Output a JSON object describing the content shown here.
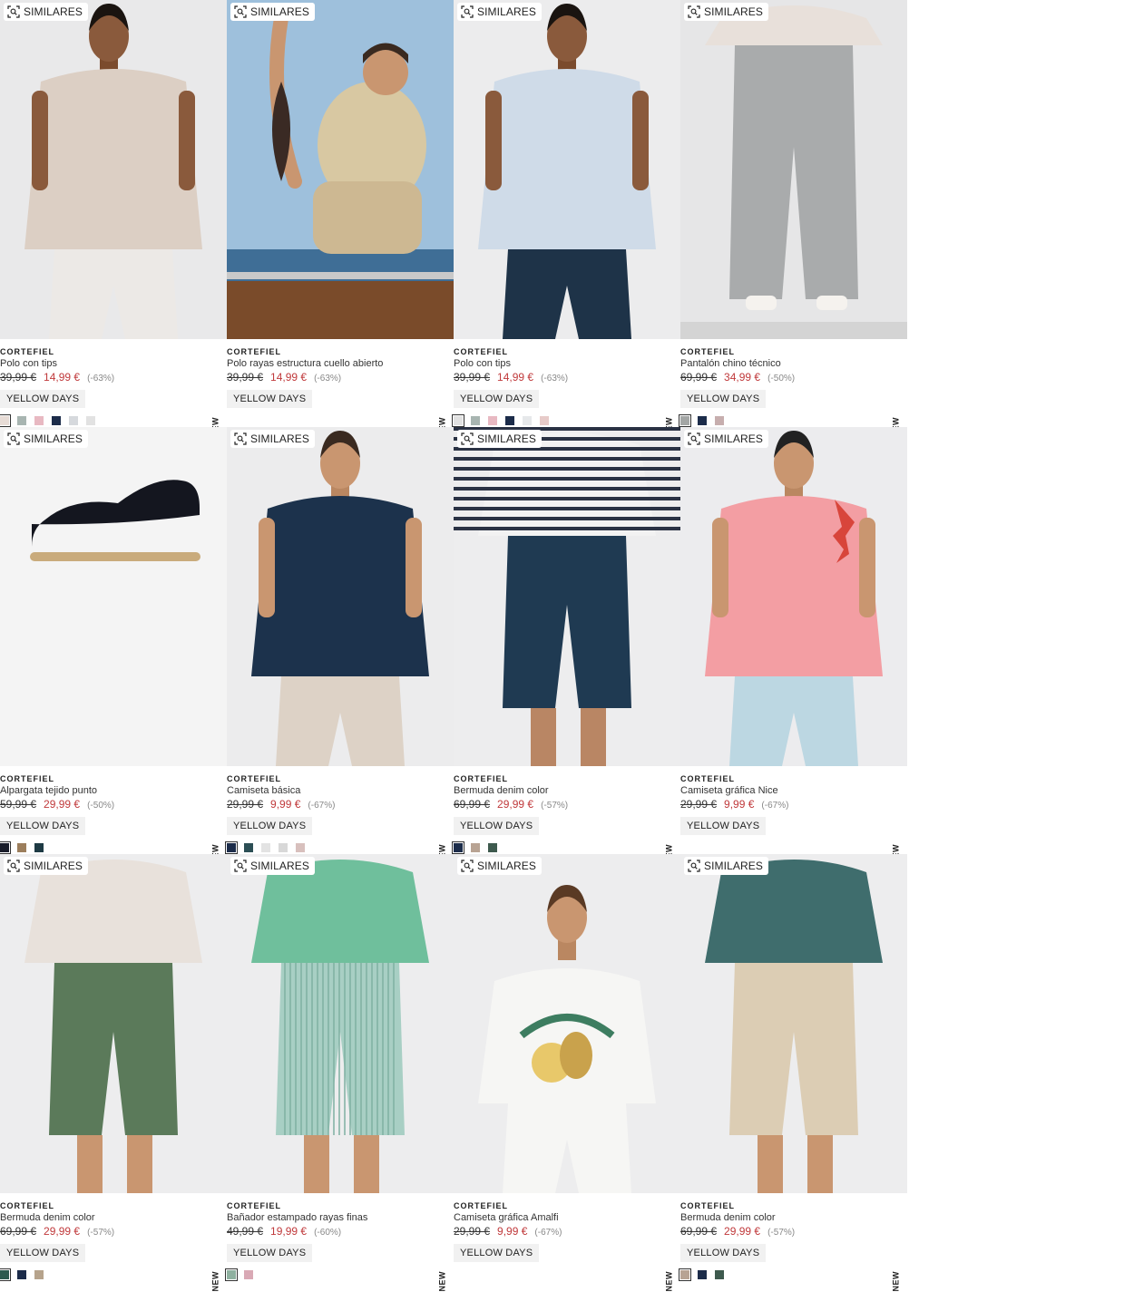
{
  "labels": {
    "similares": "SIMILARES",
    "new": "NEW",
    "badge": "YELLOW DAYS"
  },
  "products": [
    {
      "brand": "CORTEFIEL",
      "name": "Polo con tips",
      "old_price": "39,99 €",
      "price": "14,99 €",
      "discount": "(-63%)",
      "bg": "#e9e9ea",
      "colors": [
        "#e7dcd6",
        "#a8b5b1",
        "#e8b9c2",
        "#1c2c4a",
        "#d6d9dd",
        "#e2e2e2"
      ],
      "photo": {
        "skin": "#8a5a3c",
        "hair": "#1a1410",
        "top": "#dccfc4",
        "bottom": "#ece9e6",
        "view": "side"
      }
    },
    {
      "brand": "CORTEFIEL",
      "name": "Polo rayas estructura cuello abierto",
      "old_price": "39,99 €",
      "price": "14,99 €",
      "discount": "(-63%)",
      "bg": "#8fb0cf",
      "colors": [],
      "photo": {
        "skin": "#c99670",
        "hair": "#3a2a20",
        "top": "#d8c8a2",
        "bottom": "#cdb892",
        "view": "boat"
      }
    },
    {
      "brand": "CORTEFIEL",
      "name": "Polo con tips",
      "old_price": "39,99 €",
      "price": "14,99 €",
      "discount": "(-63%)",
      "bg": "#ececed",
      "colors": [
        "#e1e1e1",
        "#a8b5b1",
        "#e8b9c2",
        "#1c2c4a",
        "#e6e8ea",
        "#e7cbc9"
      ],
      "photo": {
        "skin": "#8a5a3c",
        "hair": "#1a1410",
        "top": "#cfdbe8",
        "bottom": "#1e3348",
        "view": "front"
      }
    },
    {
      "brand": "CORTEFIEL",
      "name": "Pantalón chino técnico",
      "old_price": "69,99 €",
      "price": "34,99 €",
      "discount": "(-50%)",
      "bg": "#e6e6e7",
      "colors": [
        "#a3a6a5",
        "#1c2c4a",
        "#c7aeae"
      ],
      "photo": {
        "skin": "#c99670",
        "hair": "#222",
        "top": "#e8e0da",
        "bottom": "#a9abac",
        "view": "pants"
      }
    },
    {
      "brand": "CORTEFIEL",
      "name": "Alpargata tejido punto",
      "old_price": "59,99 €",
      "price": "29,99 €",
      "discount": "(-50%)",
      "bg": "#f4f4f4",
      "colors": [
        "#1a1d2a",
        "#9c7e5c",
        "#1e3a44"
      ],
      "photo": {
        "view": "shoe"
      }
    },
    {
      "brand": "CORTEFIEL",
      "name": "Camiseta básica",
      "old_price": "29,99 €",
      "price": "9,99 €",
      "discount": "(-67%)",
      "bg": "#ececed",
      "colors": [
        "#1c2c4a",
        "#2c4f55",
        "#e3e3e3",
        "#d8d8d8",
        "#d8c0bd"
      ],
      "photo": {
        "skin": "#c99670",
        "hair": "#3a2a20",
        "top": "#1c324c",
        "bottom": "#ddd2c6",
        "view": "front"
      }
    },
    {
      "brand": "CORTEFIEL",
      "name": "Bermuda denim color",
      "old_price": "69,99 €",
      "price": "29,99 €",
      "discount": "(-57%)",
      "bg": "#ededee",
      "colors": [
        "#1c2c4a",
        "#b8a393",
        "#3e5a4e"
      ],
      "photo": {
        "skin": "#b98664",
        "hair": "#222",
        "top": "#f2f2f2",
        "bottom": "#1f3a52",
        "view": "shorts-stripes"
      }
    },
    {
      "brand": "CORTEFIEL",
      "name": "Camiseta gráfica Nice",
      "old_price": "29,99 €",
      "price": "9,99 €",
      "discount": "(-67%)",
      "bg": "#ececee",
      "colors": [],
      "photo": {
        "skin": "#c99670",
        "hair": "#222",
        "top": "#f39ea3",
        "bottom": "#bcd7e2",
        "view": "tee"
      }
    },
    {
      "brand": "CORTEFIEL",
      "name": "Bermuda denim color",
      "old_price": "69,99 €",
      "price": "29,99 €",
      "discount": "(-57%)",
      "bg": "#ededee",
      "colors": [
        "#2c5a4e",
        "#1c2c4a",
        "#b6a38c"
      ],
      "photo": {
        "skin": "#c99670",
        "hair": "#222",
        "top": "#e8e1db",
        "bottom": "#5b7a5a",
        "view": "shorts"
      }
    },
    {
      "brand": "CORTEFIEL",
      "name": "Bañador estampado rayas finas",
      "old_price": "49,99 €",
      "price": "19,99 €",
      "discount": "(-60%)",
      "bg": "#ededee",
      "colors": [
        "#8fb1a0",
        "#d9a9b5"
      ],
      "photo": {
        "skin": "#c99670",
        "hair": "#222",
        "top": "#6fbf9c",
        "bottom": "#a8cfc4",
        "view": "swim"
      }
    },
    {
      "brand": "CORTEFIEL",
      "name": "Camiseta gráfica Amalfi",
      "old_price": "29,99 €",
      "price": "9,99 €",
      "discount": "(-67%)",
      "bg": "#ededee",
      "colors": [],
      "photo": {
        "skin": "#c99670",
        "hair": "#5a3a24",
        "top": "#f6f6f4",
        "bottom": "#f6f6f4",
        "view": "amalfi"
      }
    },
    {
      "brand": "CORTEFIEL",
      "name": "Bermuda denim color",
      "old_price": "69,99 €",
      "price": "29,99 €",
      "discount": "(-57%)",
      "bg": "#ededee",
      "colors": [
        "#b8a393",
        "#1c2c4a",
        "#3e5a4e"
      ],
      "photo": {
        "skin": "#c99670",
        "hair": "#222",
        "top": "#3f6d6d",
        "bottom": "#dccdb4",
        "view": "shorts"
      }
    }
  ]
}
